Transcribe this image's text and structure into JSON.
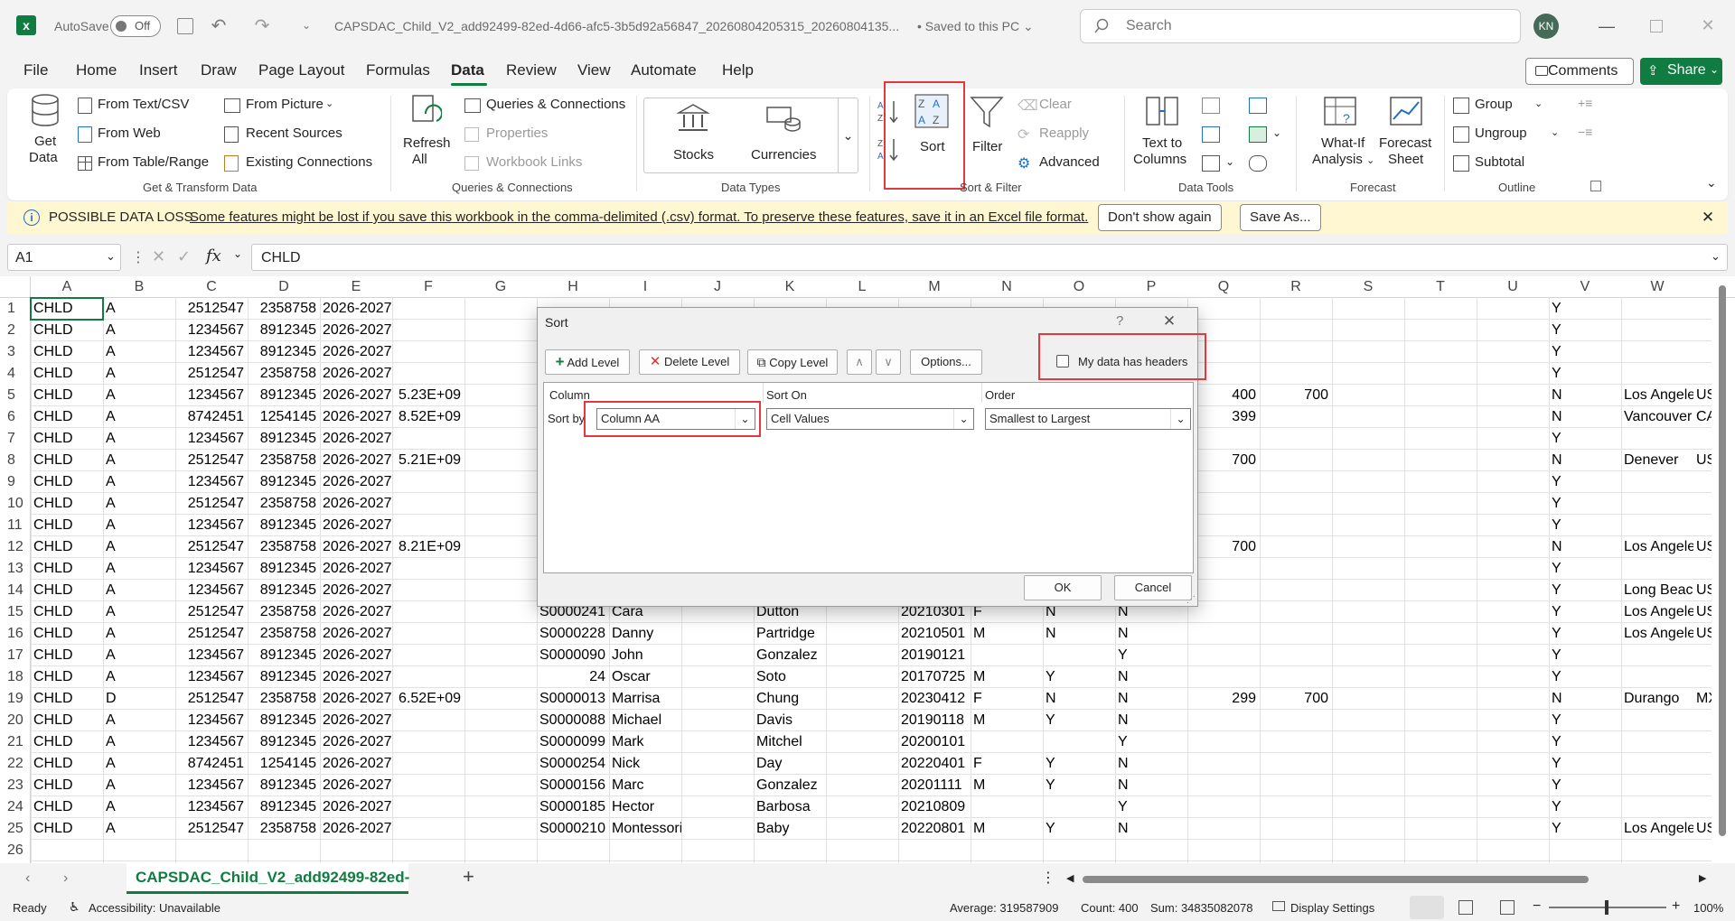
{
  "titlebar": {
    "autosave_label": "AutoSave",
    "autosave_state": "Off",
    "filename": "CAPSDAC_Child_V2_add92499-82ed-4d66-afc5-3b5d92a56847_20260804205315_20260804135...",
    "saved_status": "Saved to this PC",
    "search_placeholder": "Search",
    "user_initials": "KN"
  },
  "menu": {
    "items": [
      "File",
      "Home",
      "Insert",
      "Draw",
      "Page Layout",
      "Formulas",
      "Data",
      "Review",
      "View",
      "Automate",
      "Help"
    ],
    "active": "Data",
    "comments_label": "Comments",
    "share_label": "Share"
  },
  "ribbon": {
    "get_data": {
      "line1": "Get",
      "line2": "Data"
    },
    "from_text_csv": "From Text/CSV",
    "from_web": "From Web",
    "from_table_range": "From Table/Range",
    "from_picture": "From Picture",
    "recent_sources": "Recent Sources",
    "existing_connections": "Existing Connections",
    "group_get_transform": "Get & Transform Data",
    "refresh": {
      "line1": "Refresh",
      "line2": "All"
    },
    "queries_connections": "Queries & Connections",
    "properties": "Properties",
    "workbook_links": "Workbook Links",
    "group_queries": "Queries & Connections",
    "stocks": "Stocks",
    "currencies": "Currencies",
    "group_data_types": "Data Types",
    "sort": "Sort",
    "filter": "Filter",
    "clear": "Clear",
    "reapply": "Reapply",
    "advanced": "Advanced",
    "group_sort_filter": "Sort & Filter",
    "text_to_columns": {
      "line1": "Text to",
      "line2": "Columns"
    },
    "group_data_tools": "Data Tools",
    "what_if": {
      "line1": "What-If",
      "line2": "Analysis"
    },
    "forecast_sheet": {
      "line1": "Forecast",
      "line2": "Sheet"
    },
    "group_forecast": "Forecast",
    "group_btn": "Group",
    "ungroup": "Ungroup",
    "subtotal": "Subtotal",
    "group_outline": "Outline"
  },
  "message_bar": {
    "title": "POSSIBLE DATA LOSS",
    "text": "Some features might be lost if you save this workbook in the comma-delimited (.csv) format. To preserve these features, save it in an Excel file format.",
    "dont_show": "Don't show again",
    "save_as": "Save As..."
  },
  "formula_bar": {
    "name_box": "A1",
    "fx": "fx",
    "content": "CHLD"
  },
  "columns": [
    "A",
    "B",
    "C",
    "D",
    "E",
    "F",
    "G",
    "H",
    "I",
    "J",
    "K",
    "L",
    "M",
    "N",
    "O",
    "P",
    "Q",
    "R",
    "S",
    "T",
    "U",
    "V",
    "W"
  ],
  "rows": [
    {
      "n": "1",
      "A": "CHLD",
      "B": "A",
      "C": "2512547",
      "D": "2358758",
      "E": "2026-2027",
      "V": "Y"
    },
    {
      "n": "2",
      "A": "CHLD",
      "B": "A",
      "C": "1234567",
      "D": "8912345",
      "E": "2026-2027",
      "V": "Y"
    },
    {
      "n": "3",
      "A": "CHLD",
      "B": "A",
      "C": "1234567",
      "D": "8912345",
      "E": "2026-2027",
      "V": "Y"
    },
    {
      "n": "4",
      "A": "CHLD",
      "B": "A",
      "C": "2512547",
      "D": "2358758",
      "E": "2026-2027",
      "V": "Y"
    },
    {
      "n": "5",
      "A": "CHLD",
      "B": "A",
      "C": "1234567",
      "D": "8912345",
      "E": "2026-2027",
      "F": "5.23E+09",
      "Q": "400",
      "R": "700",
      "V": "N",
      "W": "Los Angele",
      "X": "US"
    },
    {
      "n": "6",
      "A": "CHLD",
      "B": "A",
      "C": "8742451",
      "D": "1254145",
      "E": "2026-2027",
      "F": "8.52E+09",
      "Q": "399",
      "V": "N",
      "W": "Vancouver",
      "X": "CA"
    },
    {
      "n": "7",
      "A": "CHLD",
      "B": "A",
      "C": "1234567",
      "D": "8912345",
      "E": "2026-2027",
      "V": "Y"
    },
    {
      "n": "8",
      "A": "CHLD",
      "B": "A",
      "C": "2512547",
      "D": "2358758",
      "E": "2026-2027",
      "F": "5.21E+09",
      "Q": "700",
      "V": "N",
      "W": "Denever",
      "X": "US"
    },
    {
      "n": "9",
      "A": "CHLD",
      "B": "A",
      "C": "1234567",
      "D": "8912345",
      "E": "2026-2027",
      "V": "Y"
    },
    {
      "n": "10",
      "A": "CHLD",
      "B": "A",
      "C": "2512547",
      "D": "2358758",
      "E": "2026-2027",
      "V": "Y"
    },
    {
      "n": "11",
      "A": "CHLD",
      "B": "A",
      "C": "1234567",
      "D": "8912345",
      "E": "2026-2027",
      "V": "Y"
    },
    {
      "n": "12",
      "A": "CHLD",
      "B": "A",
      "C": "2512547",
      "D": "2358758",
      "E": "2026-2027",
      "F": "8.21E+09",
      "Q": "700",
      "V": "N",
      "W": "Los Angele",
      "X": "US"
    },
    {
      "n": "13",
      "A": "CHLD",
      "B": "A",
      "C": "1234567",
      "D": "8912345",
      "E": "2026-2027",
      "V": "Y"
    },
    {
      "n": "14",
      "A": "CHLD",
      "B": "A",
      "C": "1234567",
      "D": "8912345",
      "E": "2026-2027",
      "V": "Y",
      "W": "Long Beac",
      "X": "US"
    },
    {
      "n": "15",
      "A": "CHLD",
      "B": "A",
      "C": "2512547",
      "D": "2358758",
      "E": "2026-2027",
      "H": "S0000241",
      "I": "Cara",
      "K": "Dutton",
      "M": "20210301",
      "N": "F",
      "O": "N",
      "P": "N",
      "V": "Y",
      "W": "Los Angele",
      "X": "US"
    },
    {
      "n": "16",
      "A": "CHLD",
      "B": "A",
      "C": "2512547",
      "D": "2358758",
      "E": "2026-2027",
      "H": "S0000228",
      "I": "Danny",
      "K": "Partridge",
      "M": "20210501",
      "N": "M",
      "O": "N",
      "P": "N",
      "V": "Y",
      "W": "Los Angele",
      "X": "US"
    },
    {
      "n": "17",
      "A": "CHLD",
      "B": "A",
      "C": "1234567",
      "D": "8912345",
      "E": "2026-2027",
      "H": "S0000090",
      "I": "John",
      "K": "Gonzalez",
      "M": "20190121",
      "P": "Y",
      "V": "Y"
    },
    {
      "n": "18",
      "A": "CHLD",
      "B": "A",
      "C": "1234567",
      "D": "8912345",
      "E": "2026-2027",
      "Hn": "24",
      "I": "Oscar",
      "K": "Soto",
      "M": "20170725",
      "N": "M",
      "O": "Y",
      "P": "N",
      "V": "Y"
    },
    {
      "n": "19",
      "A": "CHLD",
      "B": "D",
      "C": "2512547",
      "D": "2358758",
      "E": "2026-2027",
      "F": "6.52E+09",
      "H": "S0000013",
      "I": "Marrisa",
      "K": "Chung",
      "M": "20230412",
      "N": "F",
      "O": "N",
      "P": "N",
      "Q": "299",
      "R": "700",
      "V": "N",
      "W": "Durango",
      "X": "MX"
    },
    {
      "n": "20",
      "A": "CHLD",
      "B": "A",
      "C": "1234567",
      "D": "8912345",
      "E": "2026-2027",
      "H": "S0000088",
      "I": "Michael",
      "K": "Davis",
      "M": "20190118",
      "N": "M",
      "O": "Y",
      "P": "N",
      "V": "Y"
    },
    {
      "n": "21",
      "A": "CHLD",
      "B": "A",
      "C": "1234567",
      "D": "8912345",
      "E": "2026-2027",
      "H": "S0000099",
      "I": "Mark",
      "K": "Mitchel",
      "M": "20200101",
      "P": "Y",
      "V": "Y"
    },
    {
      "n": "22",
      "A": "CHLD",
      "B": "A",
      "C": "8742451",
      "D": "1254145",
      "E": "2026-2027",
      "H": "S0000254",
      "I": "Nick",
      "K": "Day",
      "M": "20220401",
      "N": "F",
      "O": "Y",
      "P": "N",
      "V": "Y"
    },
    {
      "n": "23",
      "A": "CHLD",
      "B": "A",
      "C": "1234567",
      "D": "8912345",
      "E": "2026-2027",
      "H": "S0000156",
      "I": "Marc",
      "K": "Gonzalez",
      "M": "20201111",
      "N": "M",
      "O": "Y",
      "P": "N",
      "V": "Y"
    },
    {
      "n": "24",
      "A": "CHLD",
      "B": "A",
      "C": "1234567",
      "D": "8912345",
      "E": "2026-2027",
      "H": "S0000185",
      "I": "Hector",
      "K": "Barbosa",
      "M": "20210809",
      "P": "Y",
      "V": "Y"
    },
    {
      "n": "25",
      "A": "CHLD",
      "B": "A",
      "C": "2512547",
      "D": "2358758",
      "E": "2026-2027",
      "H": "S0000210",
      "I": "Montessori",
      "K": "Baby",
      "M": "20220801",
      "N": "M",
      "O": "Y",
      "P": "N",
      "V": "Y",
      "W": "Los Angele",
      "X": "US"
    },
    {
      "n": "26"
    }
  ],
  "sheet_tab": {
    "name": "CAPSDAC_Child_V2_add92499-82ed-",
    "add": "+"
  },
  "status": {
    "ready": "Ready",
    "accessibility": "Accessibility: Unavailable",
    "average": "Average: 319587909",
    "count": "Count: 400",
    "sum": "Sum: 34835082078",
    "display_settings": "Display Settings",
    "zoom": "100%"
  },
  "dialog": {
    "title": "Sort",
    "help": "?",
    "add_level": "Add Level",
    "delete_level": "Delete Level",
    "copy_level": "Copy Level",
    "options": "Options...",
    "headers_label": "My data has headers",
    "headers_checked": false,
    "col_header": "Column",
    "sorton_header": "Sort On",
    "order_header": "Order",
    "sort_by": "Sort by",
    "column_value": "Column AA",
    "sorton_value": "Cell Values",
    "order_value": "Smallest to Largest",
    "ok": "OK",
    "cancel": "Cancel"
  },
  "colors": {
    "excel_green": "#107c41",
    "accent_red": "#e03a3e",
    "msg_bg": "#fff7d1"
  }
}
